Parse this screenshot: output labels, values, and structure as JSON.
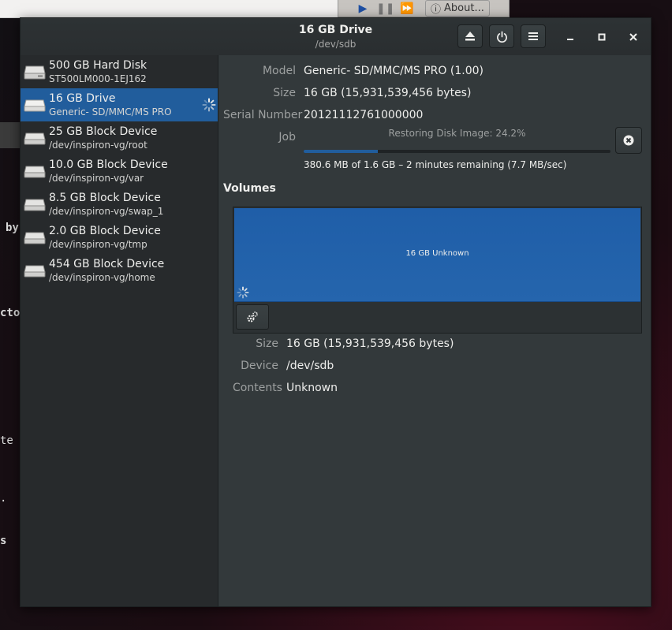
{
  "background": {
    "toolbar_about": "About...",
    "terminal_fragments": [
      "by",
      "cto",
      "te",
      ".",
      "s"
    ]
  },
  "window": {
    "title": "16 GB Drive",
    "subtitle": "/dev/sdb",
    "headerbar_icons": [
      "eject-icon",
      "power-icon",
      "menu-icon",
      "minimize-icon",
      "maximize-icon",
      "close-icon"
    ]
  },
  "drives": [
    {
      "name": "500 GB Hard Disk",
      "sub": "ST500LM000-1EJ162",
      "selected": false
    },
    {
      "name": "16 GB Drive",
      "sub": "Generic- SD/MMC/MS PRO",
      "selected": true
    },
    {
      "name": "25 GB Block Device",
      "sub": "/dev/inspiron-vg/root",
      "selected": false
    },
    {
      "name": "10.0 GB Block Device",
      "sub": "/dev/inspiron-vg/var",
      "selected": false
    },
    {
      "name": "8.5 GB Block Device",
      "sub": "/dev/inspiron-vg/swap_1",
      "selected": false
    },
    {
      "name": "2.0 GB Block Device",
      "sub": "/dev/inspiron-vg/tmp",
      "selected": false
    },
    {
      "name": "454 GB Block Device",
      "sub": "/dev/inspiron-vg/home",
      "selected": false
    }
  ],
  "drive_props": {
    "model_label": "Model",
    "model_value": "Generic- SD/MMC/MS PRO (1.00)",
    "size_label": "Size",
    "size_value": "16 GB (15,931,539,456 bytes)",
    "serial_label": "Serial Number",
    "serial_value": "20121112761000000",
    "job_label": "Job",
    "job_status": "Restoring Disk Image: 24.2%",
    "job_progress": 0.242,
    "job_detail": "380.6 MB of 1.6 GB – 2 minutes remaining (7.7 MB/sec)"
  },
  "volumes": {
    "title": "Volumes",
    "partition_label": "16 GB Unknown",
    "size_label": "Size",
    "size_value": "16 GB (15,931,539,456 bytes)",
    "device_label": "Device",
    "device_value": "/dev/sdb",
    "contents_label": "Contents",
    "contents_value": "Unknown"
  },
  "colors": {
    "accent": "#215d9c",
    "window_bg": "#33393b",
    "sidebar_bg": "#272a2c"
  }
}
